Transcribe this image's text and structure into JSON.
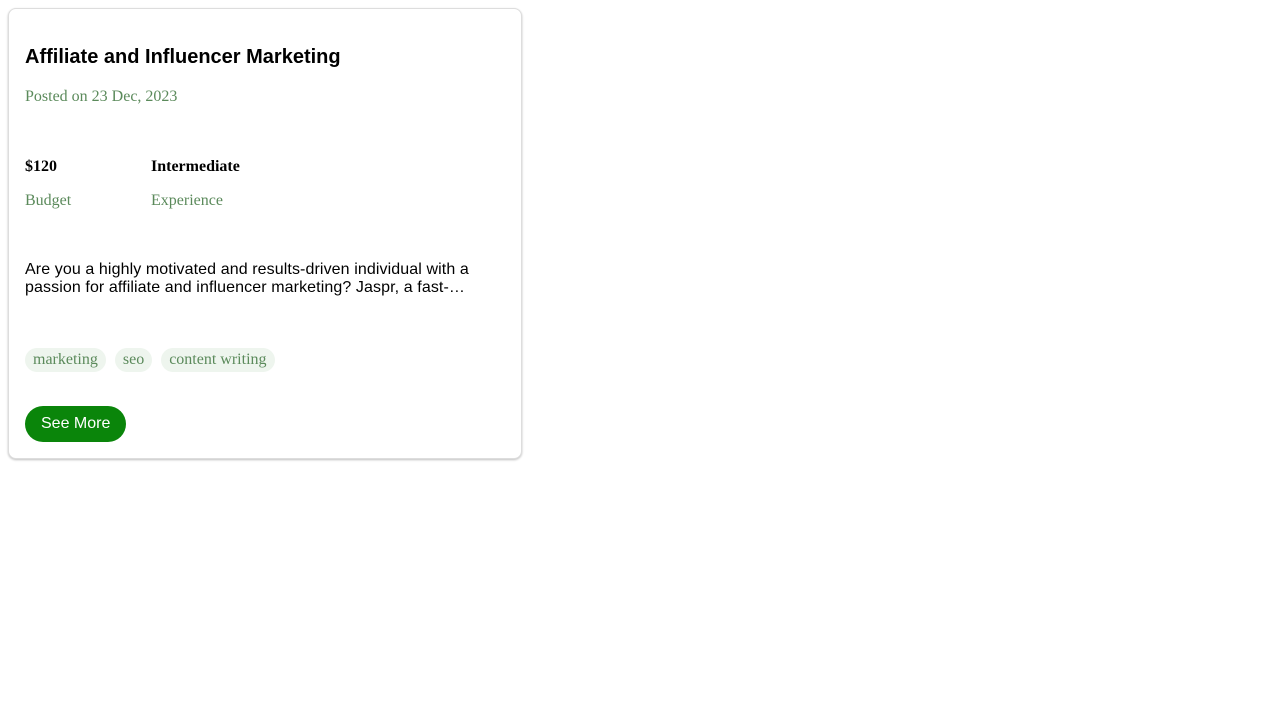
{
  "job": {
    "title": "Affiliate and Influencer Marketing",
    "posted": "Posted on 23 Dec, 2023",
    "budget_value": "$120",
    "budget_label": "Budget",
    "experience_value": "Intermediate",
    "experience_label": "Experience",
    "description": "Are you a highly motivated and results-driven individual with a passion for affiliate and influencer marketing? Jaspr, a fast-…",
    "tags": [
      "marketing",
      "seo",
      "content writing"
    ],
    "see_more_label": "See More"
  },
  "colors": {
    "accent": "#0a850a",
    "muted_text": "#5b8a5b",
    "tag_bg": "#eef5ee"
  }
}
